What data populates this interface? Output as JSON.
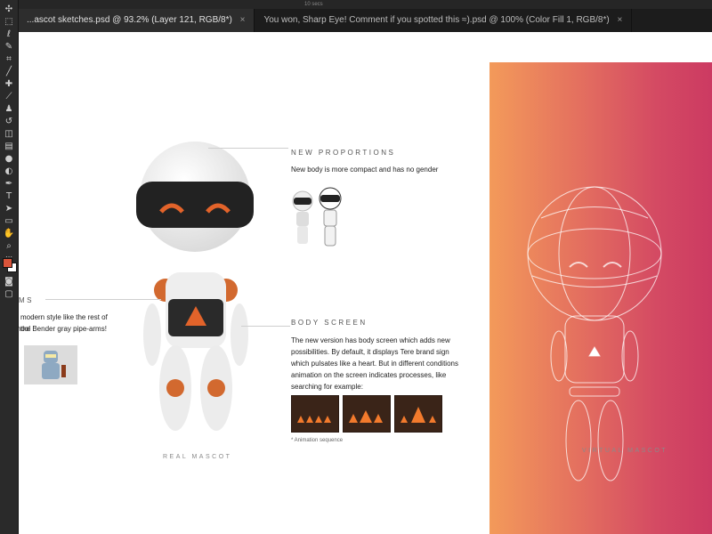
{
  "tabs": [
    {
      "label": "...ascot sketches.psd @ 93.2% (Layer 121, RGB/8*)",
      "active": true
    },
    {
      "label": "You won, Sharp Eye! Comment if you spotted this ≈).psd @ 100% (Color Fill 1, RGB/8*)",
      "active": false
    }
  ],
  "tab_close": "×",
  "top_menu": "10 secs",
  "sections": {
    "proportions": {
      "heading": "NEW PROPORTIONS",
      "text": "New body is more compact and has no gender"
    },
    "body_screen": {
      "heading": "BODY SCREEN",
      "text": "The new version has body screen which adds new possibilities. By default, it displays Tere brand sign which pulsates like a heart. But in different conditions animation on the screen indicates processes, like searching for example:",
      "note": "* Animation sequence"
    },
    "arms": {
      "heading": "MS",
      "line1": "modern style like the rest of the",
      "line2": "hool Bender gray pipe-arms!"
    }
  },
  "captions": {
    "real": "REAL MASCOT",
    "virtual": "VIRTUAL MASCOT"
  },
  "colors": {
    "foreground": "#d9543a",
    "background": "#ffffff",
    "gradient_start": "#f39a5a",
    "gradient_end": "#cc3a62",
    "visor": "#222222",
    "accent": "#e2632a"
  },
  "tools": [
    "move-icon",
    "marquee-icon",
    "lasso-icon",
    "quick-select-icon",
    "crop-icon",
    "eyedropper-icon",
    "healing-icon",
    "brush-icon",
    "stamp-icon",
    "history-brush-icon",
    "eraser-icon",
    "gradient-icon",
    "blur-icon",
    "dodge-icon",
    "pen-icon",
    "type-icon",
    "path-select-icon",
    "shape-icon",
    "hand-icon",
    "zoom-icon",
    "more-icon"
  ]
}
